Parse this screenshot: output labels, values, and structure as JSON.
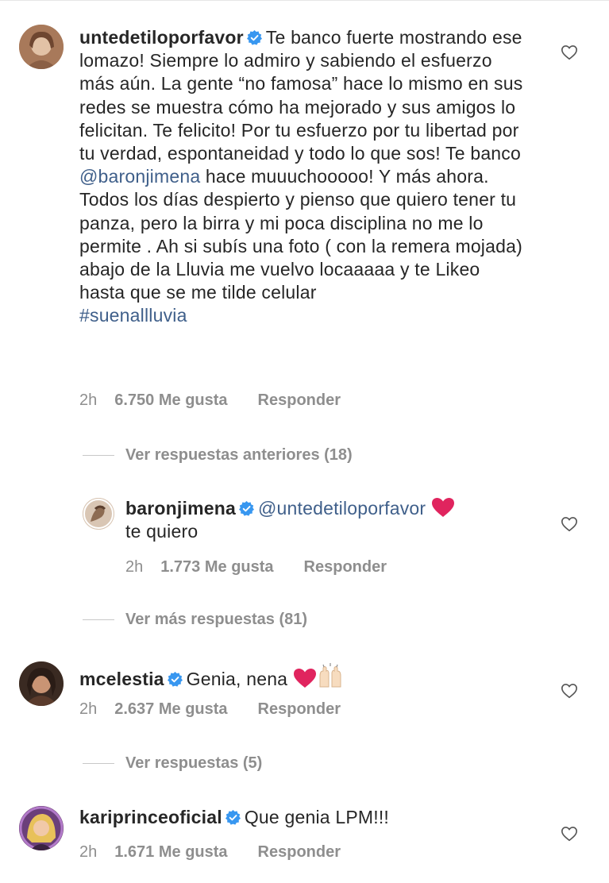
{
  "comments": [
    {
      "username": "untedetiloporfavor",
      "text_before": "Te banco fuerte mostrando ese lomazo! Siempre lo admiro y sabiendo el esfuerzo más aún. La gente “no famosa” hace lo mismo en sus redes se muestra cómo ha mejorado y sus amigos lo felicitan. Te felicito! Por tu esfuerzo por tu libertad por tu  verdad, espontaneidad y todo lo que sos! Te banco ",
      "mention": "@baronjimena",
      "text_after": "  hace muuuchooooo! Y más ahora.  Todos los días despierto y pienso que quiero tener tu panza, pero la birra y mi poca disciplina no me lo permite . Ah si subís una foto ( con la remera mojada) abajo de la Lluvia me vuelvo locaaaaa y te Likeo hasta que se me tilde celular",
      "hashtag": "#suenallluvia",
      "time": "2h",
      "likes": "6.750 Me gusta",
      "reply": "Responder"
    },
    {
      "username": "baronjimena",
      "mention": "@untedetiloporfavor",
      "text": "te quiero",
      "time": "2h",
      "likes": "1.773 Me gusta",
      "reply": "Responder"
    },
    {
      "username": "mcelestia",
      "text": "Genia, nena",
      "time": "2h",
      "likes": "2.637 Me gusta",
      "reply": "Responder"
    },
    {
      "username": "kariprinceoficial",
      "text": "Que genia LPM!!!",
      "time": "2h",
      "likes": "1.671 Me gusta",
      "reply": "Responder"
    }
  ],
  "view_previous_replies": "Ver respuestas anteriores (18)",
  "view_more_replies": "Ver más respuestas (81)",
  "view_replies": "Ver respuestas (5)",
  "colors": {
    "text": "#262626",
    "secondary": "#8e8e8e",
    "link": "#3f5f8a",
    "verified": "#3897f0",
    "heart_emoji": "#e0245e"
  },
  "icons": [
    "verified-badge-icon",
    "heart-outline-icon",
    "red-heart-emoji",
    "raising-hands-emoji"
  ]
}
